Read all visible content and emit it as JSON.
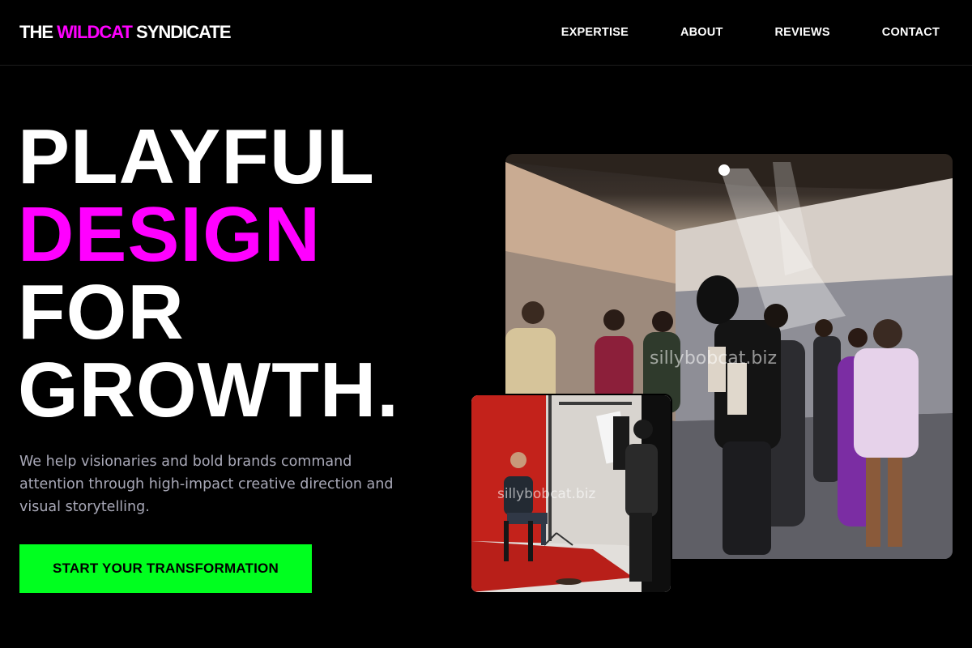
{
  "header": {
    "brand": {
      "part1": "THE ",
      "part2": "WILDCAT",
      "part3": " SYNDICATE"
    },
    "nav": [
      "EXPERTISE",
      "ABOUT",
      "REVIEWS",
      "CONTACT"
    ]
  },
  "hero": {
    "headline": [
      "PLAYFUL",
      "DESIGN",
      "FOR",
      "GROWTH."
    ],
    "subtext": "We help visionaries and bold brands command attention through high-impact creative direction and visual storytelling.",
    "cta": "START YOUR TRANSFORMATION"
  },
  "images": {
    "main_watermark": "sillybobcat.biz",
    "inset_watermark": "sillybobcat.biz"
  },
  "colors": {
    "background": "#000000",
    "accent_pink": "#ff00ff",
    "cta_green": "#00ff1f",
    "subtext_gray": "#a9a9b8"
  }
}
